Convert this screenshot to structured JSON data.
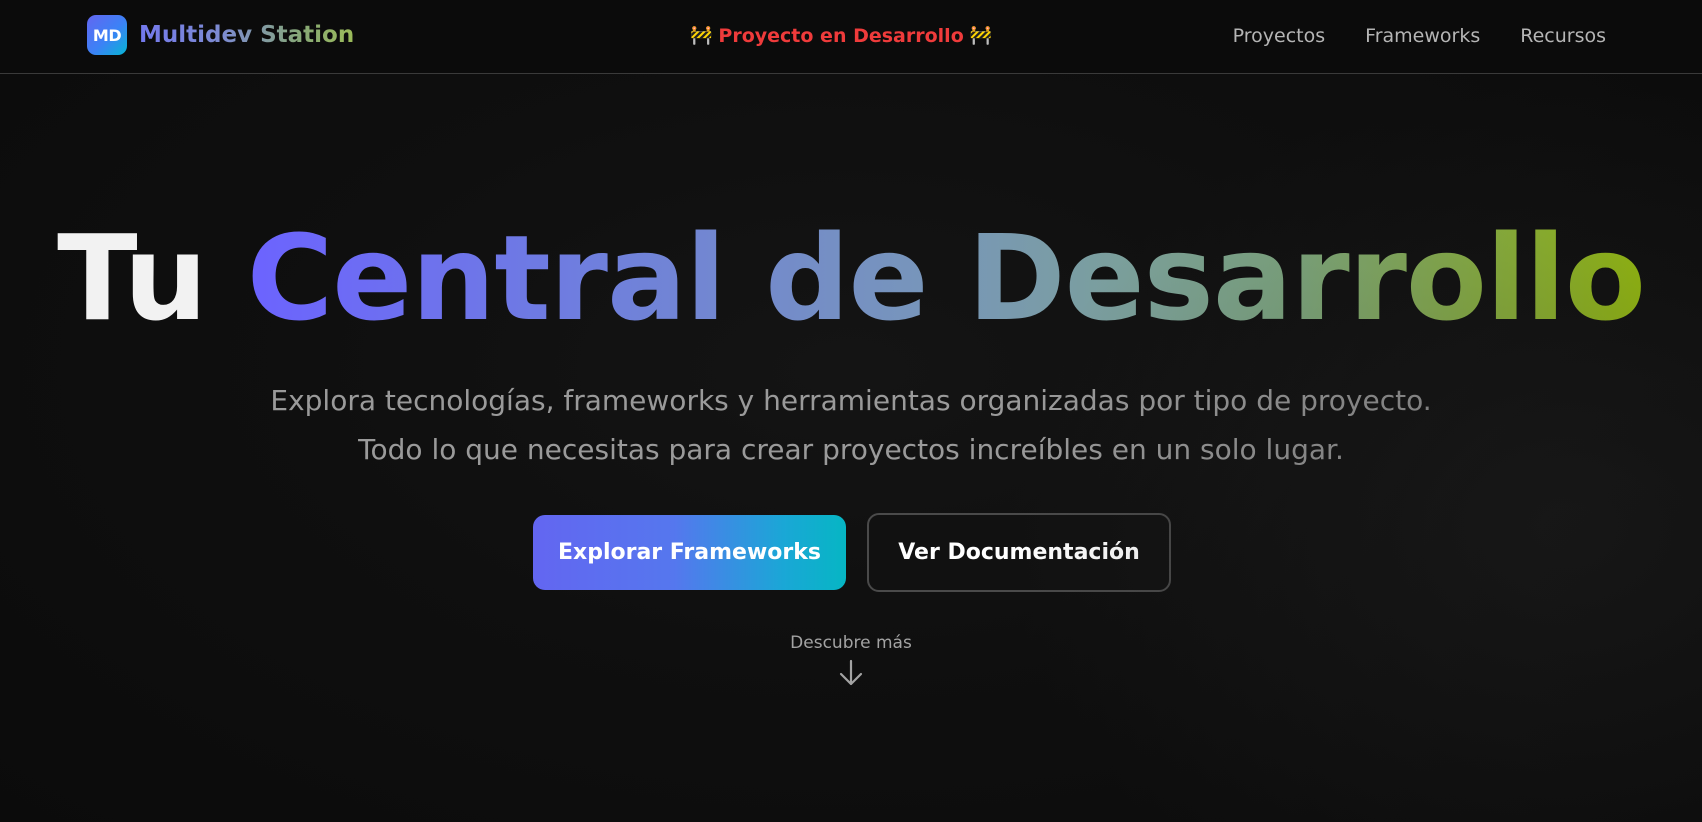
{
  "header": {
    "logo_initials": "MD",
    "brand_name": "Multidev Station",
    "dev_banner": {
      "icon": "construction-barrier-icon",
      "text": "Proyecto en Desarrollo"
    },
    "nav": [
      {
        "label": "Proyectos"
      },
      {
        "label": "Frameworks"
      },
      {
        "label": "Recursos"
      }
    ]
  },
  "hero": {
    "title_lead": "Tu",
    "title_highlight": "Central de Desarrollo",
    "subtitle_line1": "Explora tecnologías, frameworks y herramientas organizadas por tipo de proyecto.",
    "subtitle_line2": "Todo lo que necesitas para crear proyectos increíbles en un solo lugar.",
    "primary_button": "Explorar Frameworks",
    "secondary_button": "Ver Documentación",
    "discover_text": "Descubre más",
    "discover_icon": "arrow-down-icon"
  },
  "colors": {
    "background": "#0d0d0d",
    "accent_indigo": "#6366f1",
    "accent_cyan": "#06b6d4",
    "accent_lime": "#9bc20e",
    "banner_red": "#ef3b3b",
    "text_muted": "#9a9a9a"
  }
}
